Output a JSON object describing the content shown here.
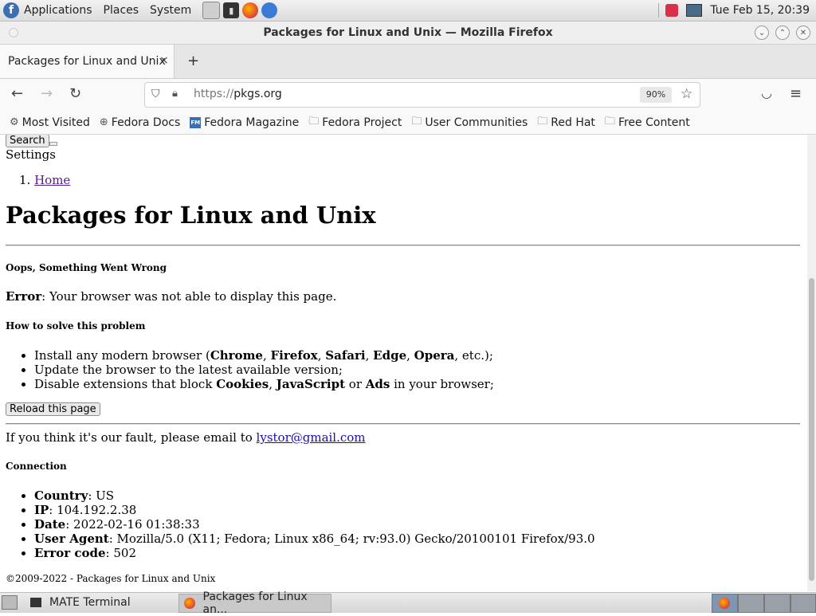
{
  "panel": {
    "menus": [
      "Applications",
      "Places",
      "System"
    ],
    "clock": "Tue Feb 15, 20:39"
  },
  "window": {
    "title": "Packages for Linux and Unix — Mozilla Firefox"
  },
  "tab": {
    "label": "Packages for Linux and Unix",
    "close": "×"
  },
  "newtab": "+",
  "navbar": {
    "url_prefix": "https://",
    "url_host": "pkgs.org",
    "zoom": "90%"
  },
  "bookmarks": [
    "Most Visited",
    "Fedora Docs",
    "Fedora Magazine",
    "Fedora Project",
    "User Communities",
    "Red Hat",
    "Free Content"
  ],
  "page": {
    "search_button": "Search",
    "settings": "Settings",
    "breadcrumb_home": "Home",
    "heading": "Packages for Linux and Unix",
    "oops": "Oops, Something Went Wrong",
    "error_label": "Error",
    "error_text": ": Your browser was not able to display this page.",
    "solve_heading": "How to solve this problem",
    "li1_pre": "Install any modern browser (",
    "chrome": "Chrome",
    "firefox": "Firefox",
    "safari": "Safari",
    "edge": "Edge",
    "opera": "Opera",
    "li1_post": ", etc.);",
    "li2": "Update the browser to the latest available version;",
    "li3_pre": "Disable extensions that block ",
    "cookies": "Cookies",
    "javascript": "JavaScript",
    "ads": "Ads",
    "li3_post": " in your browser;",
    "reload_button": "Reload this page",
    "fault_text": "If you think it's our fault, please email to ",
    "email": "lystor@gmail.com",
    "connection_heading": "Connection",
    "country_label": "Country",
    "country": ": US",
    "ip_label": "IP",
    "ip": ": 104.192.2.38",
    "date_label": "Date",
    "date": ": 2022-02-16 01:38:33",
    "ua_label": "User Agent",
    "ua": ": Mozilla/5.0 (X11; Fedora; Linux x86_64; rv:93.0) Gecko/20100101 Firefox/93.0",
    "errcode_label": "Error code",
    "errcode": ": 502",
    "footer": "©2009-2022 - Packages for Linux and Unix"
  },
  "taskbar": {
    "terminal": "MATE Terminal",
    "firefox": "Packages for Linux an..."
  }
}
